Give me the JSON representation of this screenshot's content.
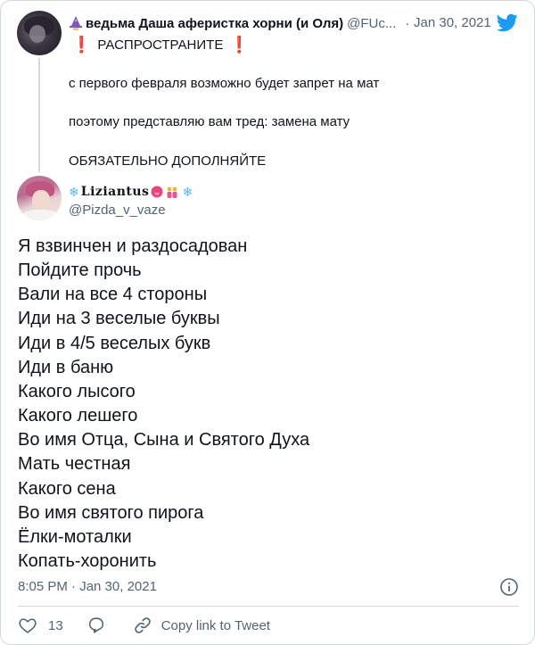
{
  "parent": {
    "author_name": "ведьма Даша аферистка хорни (и Оля)",
    "author_handle": "@FUc...",
    "date": "Jan 30, 2021",
    "headline": "РАСПРОСТРАНИТЕ",
    "paragraphs": [
      "с первого февраля возможно будет запрет на мат",
      "поэтому представляю вам тред: замена мату",
      "ОБЯЗАТЕЛЬНО ДОПОЛНЯЙТЕ"
    ]
  },
  "tweet": {
    "author_name": "Liziantus",
    "author_handle": "@Pizda_v_vaze",
    "lines": [
      "Я взвинчен и раздосадован",
      "Пойдите прочь",
      "Вали на все 4 стороны",
      "Иди на 3 веселые буквы",
      "Иди в 4/5 веселых букв",
      "Иди в баню",
      "Какого лысого",
      "Какого лешего",
      "Во имя Отца, Сына и Святого Духа",
      "Мать честная",
      "Какого сена",
      "Во имя святого пирога",
      "Ёлки-моталки",
      "Копать-хоронить"
    ],
    "timestamp": "8:05 PM · Jan 30, 2021",
    "like_count": "13",
    "copy_link_label": "Copy link to Tweet"
  },
  "colors": {
    "twitter_blue": "#1d9bf0",
    "text_secondary": "#536471",
    "alert_red": "#e0245e"
  },
  "icons": [
    "wizard-icon",
    "twitter-bird-icon",
    "exclamation-icon",
    "snowflake-icon",
    "tongue-icon",
    "people-icon",
    "info-icon",
    "heart-icon",
    "reply-icon",
    "link-icon"
  ]
}
